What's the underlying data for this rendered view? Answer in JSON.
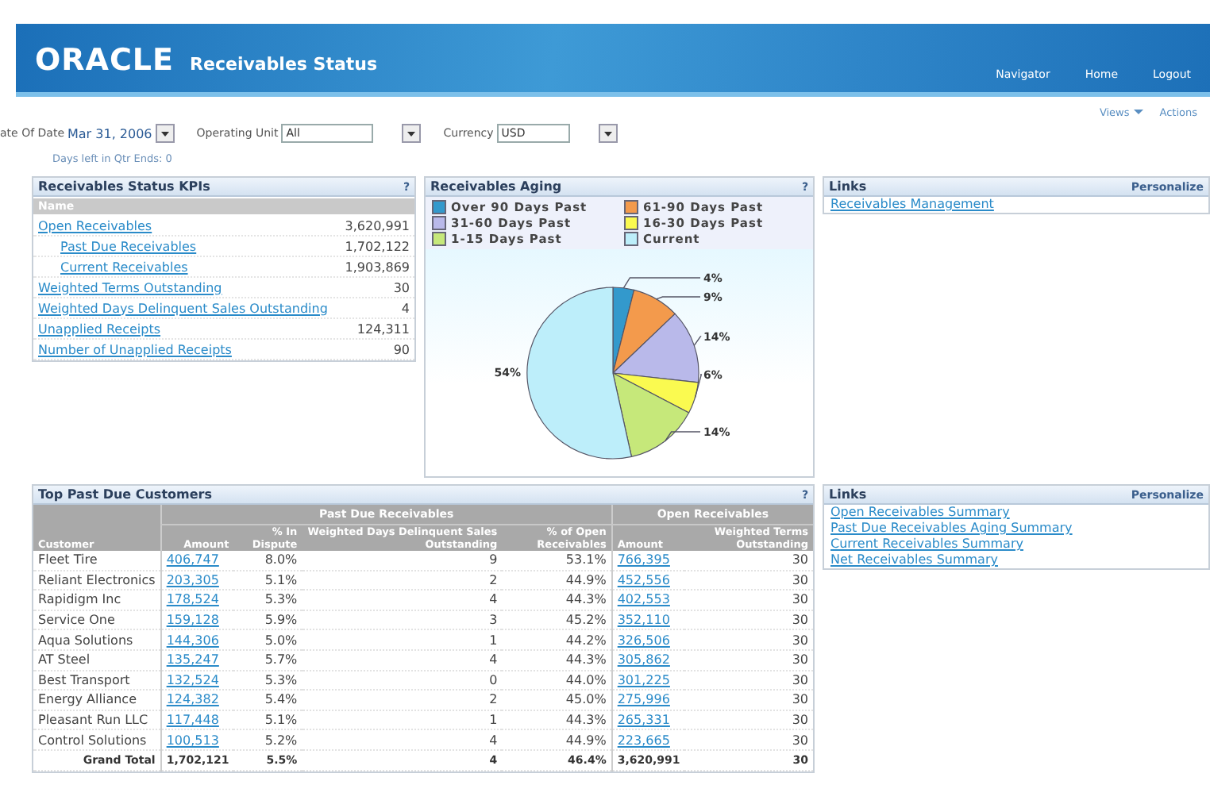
{
  "header": {
    "logo": "ORACLE",
    "title": "Receivables Status",
    "nav": [
      "Navigator",
      "Home",
      "Logout"
    ]
  },
  "page_actions": [
    {
      "label": "Views",
      "dropdown": true
    },
    {
      "label": "Actions",
      "dropdown": false
    }
  ],
  "filters": {
    "fields": [
      {
        "label": "ate Of Date",
        "value": "Mar 31, 2006",
        "kind": "date"
      },
      {
        "label": "Operating Unit",
        "value": "All",
        "kind": "select"
      },
      {
        "label": "Currency",
        "value": "USD",
        "kind": "select"
      }
    ],
    "note": "Days left in Qtr Ends: 0"
  },
  "kpi_portlet": {
    "title": "Receivables Status KPIs",
    "help": "?",
    "column": "Name",
    "rows": [
      {
        "name": "Open Receivables",
        "value": "3,620,991",
        "children": [
          {
            "name": "Past Due Receivables",
            "value": "1,702,122"
          },
          {
            "name": "Current Receivables",
            "value": "1,903,869"
          }
        ]
      },
      {
        "name": "Weighted Terms Outstanding",
        "value": "30"
      },
      {
        "name": "Weighted Days Delinquent Sales Outstanding",
        "value": "4"
      },
      {
        "name": "Unapplied Receipts",
        "value": "124,311"
      },
      {
        "name": "Number of Unapplied Receipts",
        "value": "90"
      }
    ]
  },
  "aging_portlet": {
    "title": "Receivables Aging",
    "help": "?",
    "legend": [
      {
        "label": "Over 90 Days Past",
        "color": "#3399cc"
      },
      {
        "label": "61-90 Days Past",
        "color": "#f39a4c"
      },
      {
        "label": "31-60 Days Past",
        "color": "#b9b9ea"
      },
      {
        "label": "16-30 Days Past",
        "color": "#fafa50"
      },
      {
        "label": "1-15 Days Past",
        "color": "#c6e87a"
      },
      {
        "label": "Current",
        "color": "#bdeefa"
      }
    ],
    "chart_data": {
      "type": "pie",
      "values": [
        4,
        9,
        14,
        6,
        14,
        54
      ],
      "value_labels": [
        "4%",
        "9%",
        "14%",
        "6%",
        "14%",
        "54%"
      ]
    }
  },
  "links_portlet": {
    "title": "Links",
    "action": "Personalize",
    "links": [
      "Receivables Management"
    ]
  },
  "customers_portlet": {
    "title": "Top Past Due Customers",
    "help": "?",
    "groups": [
      "Past Due Receivables",
      "Open Receivables"
    ],
    "columns": [
      "Customer",
      "Amount",
      "% In Dispute",
      "Weighted Days Delinquent Sales Outstanding",
      "% of Open Receivables",
      "Amount",
      "Weighted Terms Outstanding"
    ],
    "rows": [
      [
        "Fleet Tire",
        "406,747",
        "8.0%",
        "9",
        "53.1%",
        "766,395",
        "30"
      ],
      [
        "Reliant Electronics",
        "203,305",
        "5.1%",
        "2",
        "44.9%",
        "452,556",
        "30"
      ],
      [
        "Rapidigm Inc",
        "178,524",
        "5.3%",
        "4",
        "44.3%",
        "402,553",
        "30"
      ],
      [
        "Service One",
        "159,128",
        "5.9%",
        "3",
        "45.2%",
        "352,110",
        "30"
      ],
      [
        "Aqua Solutions",
        "144,306",
        "5.0%",
        "1",
        "44.2%",
        "326,506",
        "30"
      ],
      [
        "AT Steel",
        "135,247",
        "5.7%",
        "4",
        "44.3%",
        "305,862",
        "30"
      ],
      [
        "Best Transport",
        "132,524",
        "5.3%",
        "0",
        "44.0%",
        "301,225",
        "30"
      ],
      [
        "Energy Alliance",
        "124,382",
        "5.4%",
        "2",
        "45.0%",
        "275,996",
        "30"
      ],
      [
        "Pleasant Run LLC",
        "117,448",
        "5.1%",
        "1",
        "44.3%",
        "265,331",
        "30"
      ],
      [
        "Control Solutions",
        "100,513",
        "5.2%",
        "4",
        "44.9%",
        "223,665",
        "30"
      ]
    ],
    "total": [
      "Grand Total",
      "1,702,121",
      "5.5%",
      "4",
      "46.4%",
      "3,620,991",
      "30"
    ]
  },
  "links_portlet_2": {
    "title": "Links",
    "action": "Personalize",
    "links": [
      "Open Receivables Summary",
      "Past Due Receivables Aging Summary",
      "Current Receivables Summary",
      "Net Receivables Summary"
    ]
  }
}
